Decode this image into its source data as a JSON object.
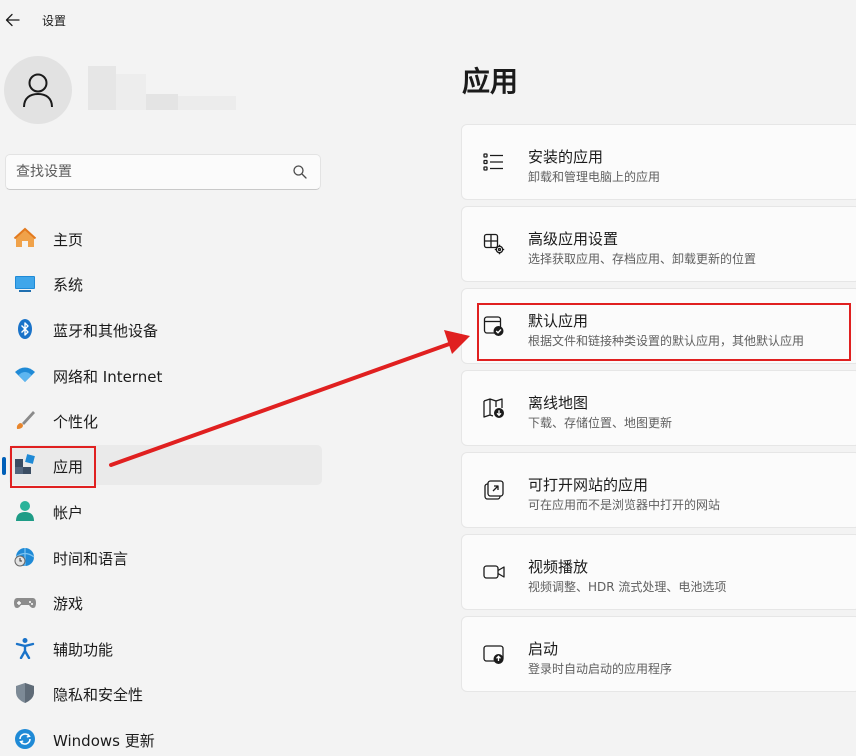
{
  "window": {
    "title": "设置"
  },
  "search": {
    "placeholder": "查找设置"
  },
  "sidebar": {
    "items": [
      {
        "label": "主页",
        "icon": "home-icon"
      },
      {
        "label": "系统",
        "icon": "system-icon"
      },
      {
        "label": "蓝牙和其他设备",
        "icon": "bluetooth-icon"
      },
      {
        "label": "网络和 Internet",
        "icon": "wifi-icon"
      },
      {
        "label": "个性化",
        "icon": "brush-icon"
      },
      {
        "label": "应用",
        "icon": "apps-icon",
        "active": true
      },
      {
        "label": "帐户",
        "icon": "account-icon"
      },
      {
        "label": "时间和语言",
        "icon": "time-language-icon"
      },
      {
        "label": "游戏",
        "icon": "gamepad-icon"
      },
      {
        "label": "辅助功能",
        "icon": "accessibility-icon"
      },
      {
        "label": "隐私和安全性",
        "icon": "shield-icon"
      },
      {
        "label": "Windows 更新",
        "icon": "windows-update-icon"
      }
    ]
  },
  "main": {
    "title": "应用",
    "cards": [
      {
        "title": "安装的应用",
        "subtitle": "卸载和管理电脑上的应用",
        "icon": "list-icon"
      },
      {
        "title": "高级应用设置",
        "subtitle": "选择获取应用、存档应用、卸载更新的位置",
        "icon": "advanced-app-settings-icon"
      },
      {
        "title": "默认应用",
        "subtitle": "根据文件和链接种类设置的默认应用，其他默认应用",
        "icon": "default-apps-icon",
        "highlighted": true
      },
      {
        "title": "离线地图",
        "subtitle": "下载、存储位置、地图更新",
        "icon": "offline-map-icon"
      },
      {
        "title": "可打开网站的应用",
        "subtitle": "可在应用而不是浏览器中打开的网站",
        "icon": "open-website-icon"
      },
      {
        "title": "视频播放",
        "subtitle": "视频调整、HDR 流式处理、电池选项",
        "icon": "video-camera-icon"
      },
      {
        "title": "启动",
        "subtitle": "登录时自动启动的应用程序",
        "icon": "startup-icon"
      }
    ]
  },
  "colors": {
    "accent": "#005fb8",
    "annotation": "#e02020",
    "background": "#f3f3f3"
  }
}
